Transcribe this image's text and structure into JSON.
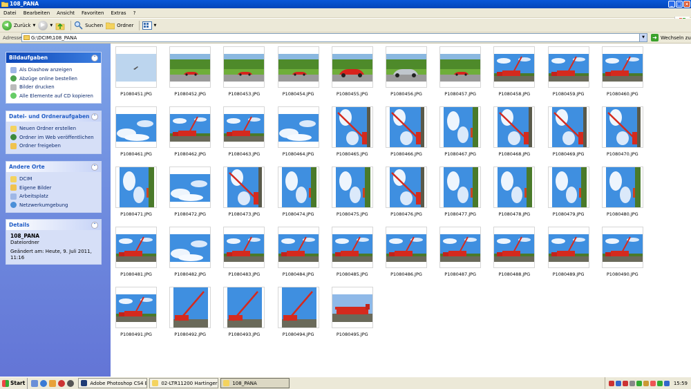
{
  "window": {
    "title": "108_PANA"
  },
  "menu": [
    "Datei",
    "Bearbeiten",
    "Ansicht",
    "Favoriten",
    "Extras",
    "?"
  ],
  "toolbar": {
    "back": "Zurück",
    "search": "Suchen",
    "folders": "Ordner"
  },
  "address": {
    "label": "Adresse",
    "value": "G:\\DCIM\\108_PANA",
    "go": "Wechseln zu"
  },
  "tasks": {
    "picture": {
      "title": "Bildaufgaben",
      "items": [
        "Als Diashow anzeigen",
        "Abzüge online bestellen",
        "Bilder drucken",
        "Alle Elemente auf CD kopieren"
      ]
    },
    "file": {
      "title": "Datei- und Ordneraufgaben",
      "items": [
        "Neuen Ordner erstellen",
        "Ordner im Web veröffentlichen",
        "Ordner freigeben"
      ]
    },
    "places": {
      "title": "Andere Orte",
      "items": [
        "DCIM",
        "Eigene Bilder",
        "Arbeitsplatz",
        "Netzwerkumgebung"
      ]
    },
    "details": {
      "title": "Details",
      "name": "108_PANA",
      "type": "Dateiordner",
      "modified": "Geändert am: Heute, 9. Juli 2011, 11:16"
    }
  },
  "files": [
    {
      "name": "P1080451.JPG",
      "kind": "sky-plane"
    },
    {
      "name": "P1080452.JPG",
      "kind": "car"
    },
    {
      "name": "P1080453.JPG",
      "kind": "car"
    },
    {
      "name": "P1080454.JPG",
      "kind": "car"
    },
    {
      "name": "P1080455.JPG",
      "kind": "car-big"
    },
    {
      "name": "P1080456.JPG",
      "kind": "car-silver"
    },
    {
      "name": "P1080457.JPG",
      "kind": "car"
    },
    {
      "name": "P1080458.JPG",
      "kind": "crane"
    },
    {
      "name": "P1080459.JPG",
      "kind": "crane"
    },
    {
      "name": "P1080460.JPG",
      "kind": "crane"
    },
    {
      "name": "P1080461.JPG",
      "kind": "sky"
    },
    {
      "name": "P1080462.JPG",
      "kind": "crane"
    },
    {
      "name": "P1080463.JPG",
      "kind": "crane"
    },
    {
      "name": "P1080464.JPG",
      "kind": "sky"
    },
    {
      "name": "P1080465.JPG",
      "kind": "crane-rot"
    },
    {
      "name": "P1080466.JPG",
      "kind": "crane-rot"
    },
    {
      "name": "P1080467.JPG",
      "kind": "sky-rot"
    },
    {
      "name": "P1080468.JPG",
      "kind": "crane-rot"
    },
    {
      "name": "P1080469.JPG",
      "kind": "crane-rot"
    },
    {
      "name": "P1080470.JPG",
      "kind": "crane-rot"
    },
    {
      "name": "P1080471.JPG",
      "kind": "sky-rot"
    },
    {
      "name": "P1080472.JPG",
      "kind": "sky"
    },
    {
      "name": "P1080473.JPG",
      "kind": "crane-rot"
    },
    {
      "name": "P1080474.JPG",
      "kind": "sky-rot"
    },
    {
      "name": "P1080475.JPG",
      "kind": "sky-rot"
    },
    {
      "name": "P1080476.JPG",
      "kind": "crane-rot"
    },
    {
      "name": "P1080477.JPG",
      "kind": "sky-rot"
    },
    {
      "name": "P1080478.JPG",
      "kind": "sky-rot"
    },
    {
      "name": "P1080479.JPG",
      "kind": "sky-rot"
    },
    {
      "name": "P1080480.JPG",
      "kind": "sky-rot"
    },
    {
      "name": "P1080481.JPG",
      "kind": "crane"
    },
    {
      "name": "P1080482.JPG",
      "kind": "sky"
    },
    {
      "name": "P1080483.JPG",
      "kind": "crane"
    },
    {
      "name": "P1080484.JPG",
      "kind": "crane"
    },
    {
      "name": "P1080485.JPG",
      "kind": "crane"
    },
    {
      "name": "P1080486.JPG",
      "kind": "crane"
    },
    {
      "name": "P1080487.JPG",
      "kind": "crane"
    },
    {
      "name": "P1080488.JPG",
      "kind": "crane"
    },
    {
      "name": "P1080489.JPG",
      "kind": "crane"
    },
    {
      "name": "P1080490.JPG",
      "kind": "crane"
    },
    {
      "name": "P1080491.JPG",
      "kind": "crane"
    },
    {
      "name": "P1080492.JPG",
      "kind": "crane-tall"
    },
    {
      "name": "P1080493.JPG",
      "kind": "crane-tall"
    },
    {
      "name": "P1080494.JPG",
      "kind": "crane-tall"
    },
    {
      "name": "P1080495.JPG",
      "kind": "crane-flat"
    }
  ],
  "taskbar": {
    "start": "Start",
    "tasks": [
      "Adobe Photoshop CS4 E...",
      "02-LTR11200 Hartinger ...",
      "108_PANA"
    ],
    "clock": "15:59"
  },
  "colors": {
    "title": "#0a59d8",
    "sidebar": "#7ba2e7",
    "sky": "#3f8fe0",
    "crane": "#d42a1e",
    "grass": "#4e9a2a"
  }
}
